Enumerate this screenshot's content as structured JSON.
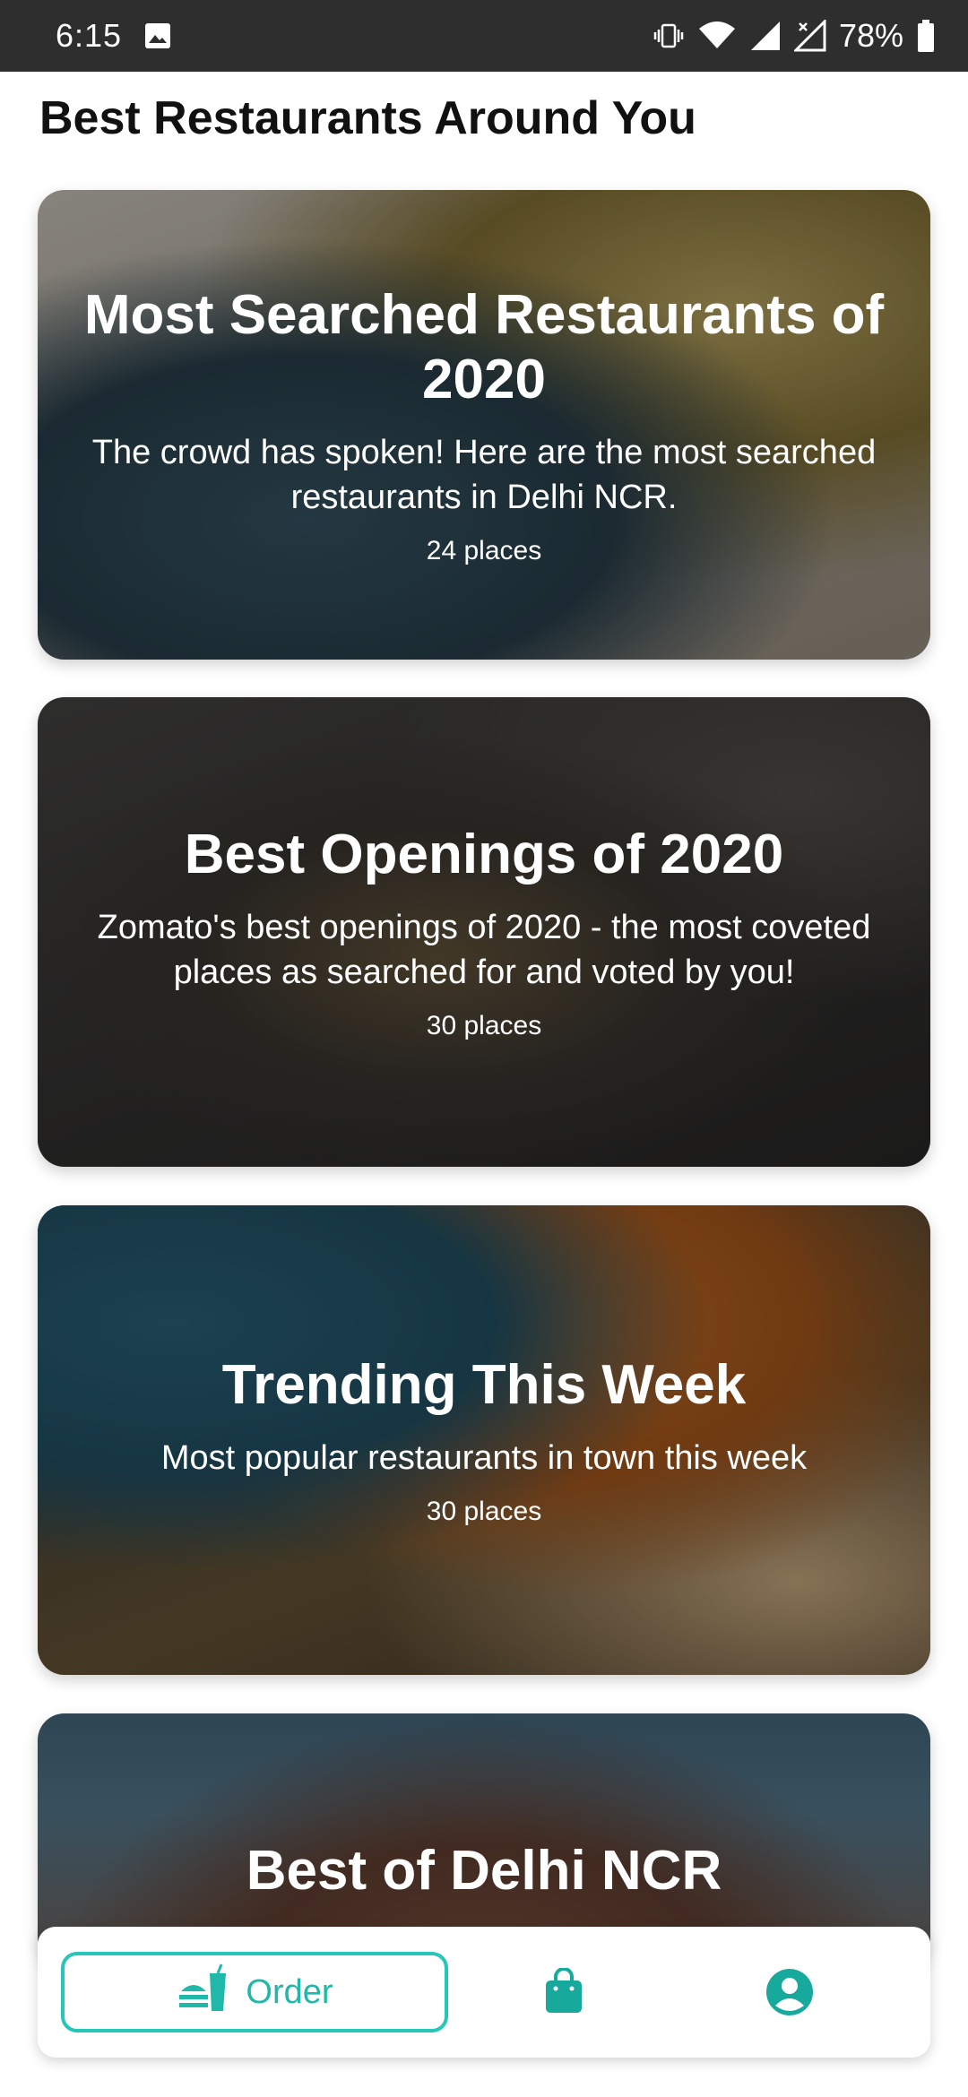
{
  "status_bar": {
    "time": "6:15",
    "battery": "78%",
    "icons": [
      "gallery-icon",
      "vibrate-icon",
      "wifi-icon",
      "signal-r-icon",
      "signal-x-icon",
      "battery-icon"
    ]
  },
  "page": {
    "title": "Best Restaurants Around You"
  },
  "collections": [
    {
      "title": "Most Searched Restaurants of 2020",
      "description": "The crowd has spoken! Here are the most searched restaurants in Delhi NCR.",
      "count": "24 places"
    },
    {
      "title": "Best Openings of 2020",
      "description": "Zomato's best openings of 2020 - the most coveted places as searched for and voted by you!",
      "count": "30 places"
    },
    {
      "title": "Trending This Week",
      "description": "Most popular restaurants in town this week",
      "count": "30 places"
    },
    {
      "title": "Best of Delhi NCR"
    }
  ],
  "bottom_nav": {
    "order_label": "Order",
    "accent_color": "#26c6b8",
    "icons": [
      "order-food-icon",
      "shopping-bag-icon",
      "account-icon"
    ]
  }
}
